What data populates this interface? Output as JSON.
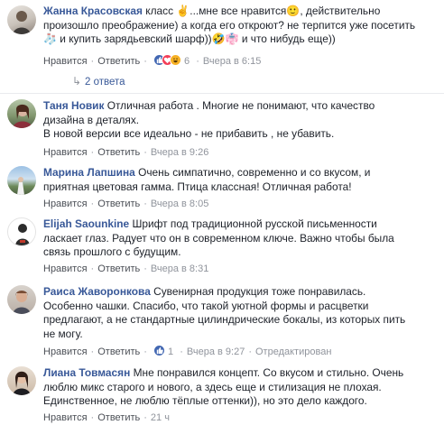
{
  "comments": [
    {
      "author": "Жанна Красовская",
      "lines": [
        [
          "класс ",
          "✌️",
          "...мне все нравится",
          "🙂",
          ", действительно"
        ],
        [
          "произошло преображение) а когда его откроют? не терпится уже посетить"
        ],
        [
          "🧦",
          " и купить зарядьевский шарф))",
          "🤣",
          "👘",
          " и что нибудь еще))"
        ]
      ],
      "like": "Нравится",
      "reply": "Ответить",
      "reaction_count": "6",
      "time": "Вчера в 6:15",
      "replies_label": "2 ответа"
    },
    {
      "author": "Таня Новик",
      "lines": [
        [
          "Отличная работа . Многие не понимают, что качество"
        ],
        [
          "дизайна в деталях."
        ],
        [
          "В новой версии все идеально - не прибавить , не убавить."
        ]
      ],
      "like": "Нравится",
      "reply": "Ответить",
      "time": "Вчера в 9:26"
    },
    {
      "author": "Марина Лапшина",
      "lines": [
        [
          "Очень симпатично, современно и со вкусом, и"
        ],
        [
          "приятная цветовая гамма. Птица классная! Отличная работа!"
        ]
      ],
      "like": "Нравится",
      "reply": "Ответить",
      "time": "Вчера в 8:05"
    },
    {
      "author": "Elijah Saounkine",
      "lines": [
        [
          "Шрифт под традиционной русской письменности"
        ],
        [
          "ласкает глаз. Радует что он в современном ключе. Важно чтобы была"
        ],
        [
          "связь прошлого с будущим."
        ]
      ],
      "like": "Нравится",
      "reply": "Ответить",
      "time": "Вчера в 8:31"
    },
    {
      "author": "Раиса Жаворонкова",
      "lines": [
        [
          "Сувенирная продукция тоже понравилась."
        ],
        [
          "Особенно чашки. Спасибо, что такой уютной формы и расцветки"
        ],
        [
          "предлагают, а не стандартные цилиндрические бокалы, из которых пить"
        ],
        [
          "не могу."
        ]
      ],
      "like": "Нравится",
      "reply": "Ответить",
      "reaction_count": "1",
      "time": "Вчера в 9:27",
      "edited": "Отредактирован"
    },
    {
      "author": "Лиана Товмасян",
      "lines": [
        [
          "Мне понравился концепт. Со вкусом и стильно. Очень"
        ],
        [
          "люблю микс старого и нового, а здесь еще и стилизация не плохая."
        ],
        [
          "Единственное, не люблю тёплые оттенки)), но это дело каждого."
        ]
      ],
      "like": "Нравится",
      "reply": "Ответить",
      "time": "21 ч"
    }
  ],
  "colors": {
    "author": "#385898",
    "meta": "#90949c",
    "text": "#1d2129",
    "like_reaction": "#4267b2",
    "love_reaction": "#f33e58",
    "haha_reaction": "#f7b125"
  }
}
